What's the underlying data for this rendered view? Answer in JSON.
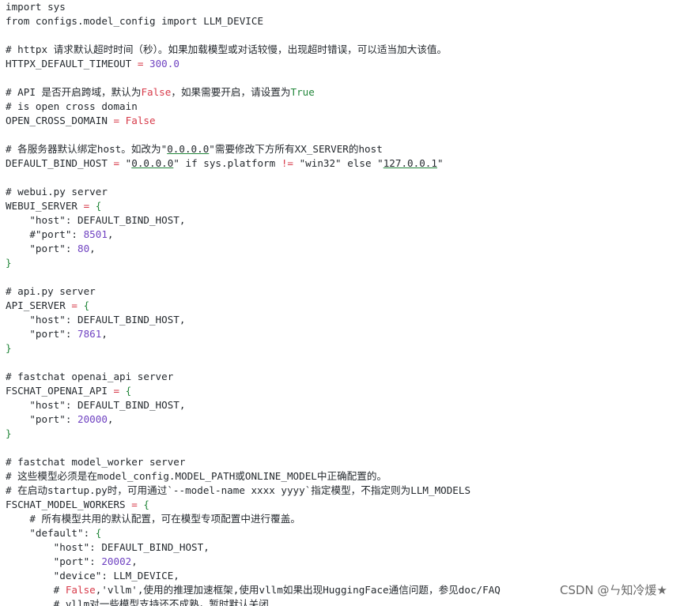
{
  "lines": [
    [
      {
        "t": "import sys",
        "c": "plain"
      }
    ],
    [
      {
        "t": "from configs.model_config import LLM_DEVICE",
        "c": "plain"
      }
    ],
    [
      {
        "t": "",
        "c": "plain"
      }
    ],
    [
      {
        "t": "# httpx 请求默认超时时间（秒）。如果加载模型或对话较慢，出现超时错误，可以适当加大该值。",
        "c": "cmt"
      }
    ],
    [
      {
        "t": "HTTPX_DEFAULT_TIMEOUT ",
        "c": "plain"
      },
      {
        "t": "=",
        "c": "op"
      },
      {
        "t": " ",
        "c": "plain"
      },
      {
        "t": "300.0",
        "c": "num"
      }
    ],
    [
      {
        "t": "",
        "c": "plain"
      }
    ],
    [
      {
        "t": "# API 是否开启跨域，默认为",
        "c": "cmt"
      },
      {
        "t": "False",
        "c": "kw-false"
      },
      {
        "t": "，如果需要开启，请设置为",
        "c": "cmt"
      },
      {
        "t": "True",
        "c": "kw-true"
      }
    ],
    [
      {
        "t": "# is open cross domain",
        "c": "cmt"
      }
    ],
    [
      {
        "t": "OPEN_CROSS_DOMAIN ",
        "c": "plain"
      },
      {
        "t": "=",
        "c": "op"
      },
      {
        "t": " ",
        "c": "plain"
      },
      {
        "t": "False",
        "c": "kw-false"
      }
    ],
    [
      {
        "t": "",
        "c": "plain"
      }
    ],
    [
      {
        "t": "# 各服务器默认绑定host。如改为\"",
        "c": "cmt"
      },
      {
        "t": "0.0.0.0",
        "c": "ul"
      },
      {
        "t": "\"需要修改下方所有XX_SERVER的host",
        "c": "cmt"
      }
    ],
    [
      {
        "t": "DEFAULT_BIND_HOST ",
        "c": "plain"
      },
      {
        "t": "=",
        "c": "op"
      },
      {
        "t": " \"",
        "c": "plain"
      },
      {
        "t": "0.0.0.0",
        "c": "ul"
      },
      {
        "t": "\" if sys.platform ",
        "c": "plain"
      },
      {
        "t": "!=",
        "c": "op"
      },
      {
        "t": " \"win32\" else \"",
        "c": "plain"
      },
      {
        "t": "127.0.0.1",
        "c": "ul"
      },
      {
        "t": "\"",
        "c": "plain"
      }
    ],
    [
      {
        "t": "",
        "c": "plain"
      }
    ],
    [
      {
        "t": "# webui.py server",
        "c": "cmt"
      }
    ],
    [
      {
        "t": "WEBUI_SERVER ",
        "c": "plain"
      },
      {
        "t": "=",
        "c": "op"
      },
      {
        "t": " ",
        "c": "plain"
      },
      {
        "t": "{",
        "c": "brace"
      }
    ],
    [
      {
        "t": "    \"host\": DEFAULT_BIND_HOST,",
        "c": "plain"
      }
    ],
    [
      {
        "t": "    #\"port\": ",
        "c": "plain"
      },
      {
        "t": "8501",
        "c": "num"
      },
      {
        "t": ",",
        "c": "plain"
      }
    ],
    [
      {
        "t": "    \"port\": ",
        "c": "plain"
      },
      {
        "t": "80",
        "c": "num"
      },
      {
        "t": ",",
        "c": "plain"
      }
    ],
    [
      {
        "t": "}",
        "c": "brace"
      }
    ],
    [
      {
        "t": "",
        "c": "plain"
      }
    ],
    [
      {
        "t": "# api.py server",
        "c": "cmt"
      }
    ],
    [
      {
        "t": "API_SERVER ",
        "c": "plain"
      },
      {
        "t": "=",
        "c": "op"
      },
      {
        "t": " ",
        "c": "plain"
      },
      {
        "t": "{",
        "c": "brace"
      }
    ],
    [
      {
        "t": "    \"host\": DEFAULT_BIND_HOST,",
        "c": "plain"
      }
    ],
    [
      {
        "t": "    \"port\": ",
        "c": "plain"
      },
      {
        "t": "7861",
        "c": "num"
      },
      {
        "t": ",",
        "c": "plain"
      }
    ],
    [
      {
        "t": "}",
        "c": "brace"
      }
    ],
    [
      {
        "t": "",
        "c": "plain"
      }
    ],
    [
      {
        "t": "# fastchat openai_api server",
        "c": "cmt"
      }
    ],
    [
      {
        "t": "FSCHAT_OPENAI_API ",
        "c": "plain"
      },
      {
        "t": "=",
        "c": "op"
      },
      {
        "t": " ",
        "c": "plain"
      },
      {
        "t": "{",
        "c": "brace"
      }
    ],
    [
      {
        "t": "    \"host\": DEFAULT_BIND_HOST,",
        "c": "plain"
      }
    ],
    [
      {
        "t": "    \"port\": ",
        "c": "plain"
      },
      {
        "t": "20000",
        "c": "num"
      },
      {
        "t": ",",
        "c": "plain"
      }
    ],
    [
      {
        "t": "}",
        "c": "brace"
      }
    ],
    [
      {
        "t": "",
        "c": "plain"
      }
    ],
    [
      {
        "t": "# fastchat model_worker server",
        "c": "cmt"
      }
    ],
    [
      {
        "t": "# 这些模型必须是在model_config.MODEL_PATH或ONLINE_MODEL中正确配置的。",
        "c": "cmt"
      }
    ],
    [
      {
        "t": "# 在启动startup.py时，可用通过`--model-name xxxx yyyy`指定模型，不指定则为LLM_MODELS",
        "c": "cmt"
      }
    ],
    [
      {
        "t": "FSCHAT_MODEL_WORKERS ",
        "c": "plain"
      },
      {
        "t": "=",
        "c": "op"
      },
      {
        "t": " ",
        "c": "plain"
      },
      {
        "t": "{",
        "c": "brace"
      }
    ],
    [
      {
        "t": "    # 所有模型共用的默认配置，可在模型专项配置中进行覆盖。",
        "c": "cmt"
      }
    ],
    [
      {
        "t": "    \"default\": ",
        "c": "plain"
      },
      {
        "t": "{",
        "c": "brace"
      }
    ],
    [
      {
        "t": "        \"host\": DEFAULT_BIND_HOST,",
        "c": "plain"
      }
    ],
    [
      {
        "t": "        \"port\": ",
        "c": "plain"
      },
      {
        "t": "20002",
        "c": "num"
      },
      {
        "t": ",",
        "c": "plain"
      }
    ],
    [
      {
        "t": "        \"device\": LLM_DEVICE,",
        "c": "plain"
      }
    ],
    [
      {
        "t": "        # ",
        "c": "cmt"
      },
      {
        "t": "False",
        "c": "kw-false"
      },
      {
        "t": ",'vllm',使用的推理加速框架,使用vllm如果出现HuggingFace通信问题，参见doc/FAQ",
        "c": "cmt"
      }
    ],
    [
      {
        "t": "        # vllm对一些模型支持还不成熟，暂时默认关闭",
        "c": "cmt"
      }
    ]
  ],
  "watermark": "CSDN @ㄣ知冷煖★"
}
